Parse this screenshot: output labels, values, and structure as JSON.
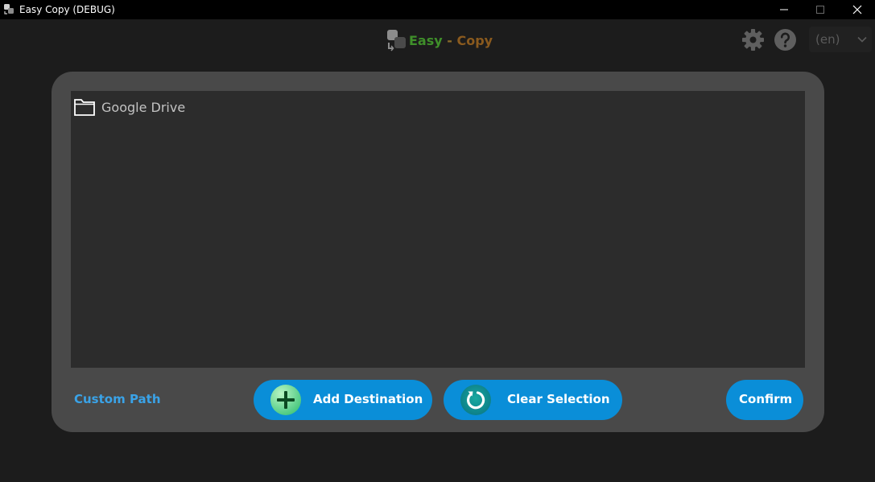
{
  "window": {
    "title": "Easy Copy (DEBUG)"
  },
  "header": {
    "logo_easy": "Easy",
    "logo_separator": " - ",
    "logo_copy": "Copy",
    "language_value": "(en)"
  },
  "destinations": {
    "items": [
      {
        "label": "Google Drive",
        "icon": "folder-icon"
      }
    ]
  },
  "actions": {
    "custom_path_label": "Custom Path",
    "add_destination_label": "Add Destination",
    "clear_selection_label": "Clear Selection",
    "confirm_label": "Confirm"
  },
  "colors": {
    "accent": "#0a8ed8",
    "link": "#3aa3e8",
    "logo_easy": "#3f8f2a",
    "logo_copy": "#8a5a1e",
    "panel": "#494949",
    "background": "#1c1c1c"
  }
}
